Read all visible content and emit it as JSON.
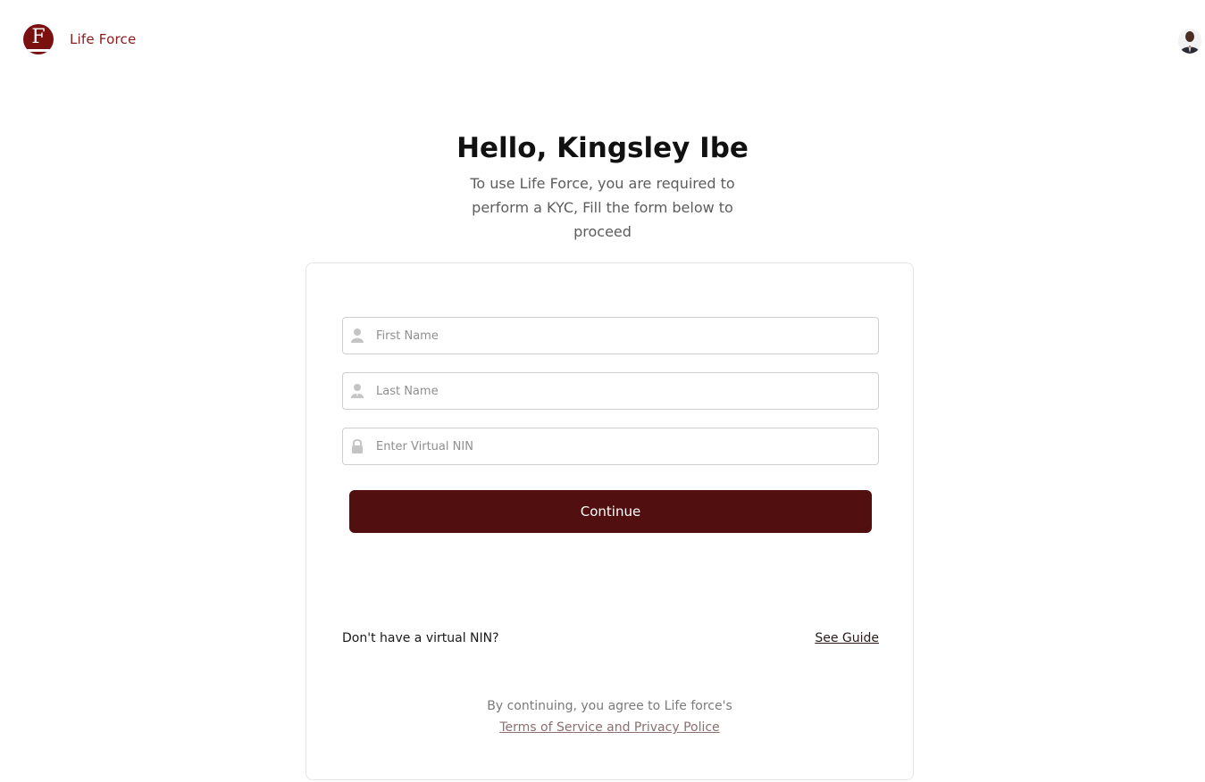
{
  "header": {
    "brand_name": "Life Force",
    "logo_letter": "F",
    "brand_color": "#8b1a1a"
  },
  "greeting": {
    "title": "Hello, Kingsley Ibe",
    "subtitle": "To use Life Force, you are required to perform a KYC, Fill the form below to proceed"
  },
  "form": {
    "first_name": {
      "placeholder": "First Name",
      "value": "",
      "icon": "user-icon"
    },
    "last_name": {
      "placeholder": "Last Name",
      "value": "",
      "icon": "user-tie-icon"
    },
    "virtual_nin": {
      "placeholder": "Enter Virtual NIN",
      "value": "",
      "icon": "lock-icon"
    },
    "continue_label": "Continue",
    "button_color": "#520f10"
  },
  "help": {
    "question": "Don't have a virtual NIN?",
    "guide_link": "See Guide"
  },
  "legal": {
    "text": "By continuing, you agree to Life force's",
    "link": "Terms of Service and Privacy Police"
  }
}
